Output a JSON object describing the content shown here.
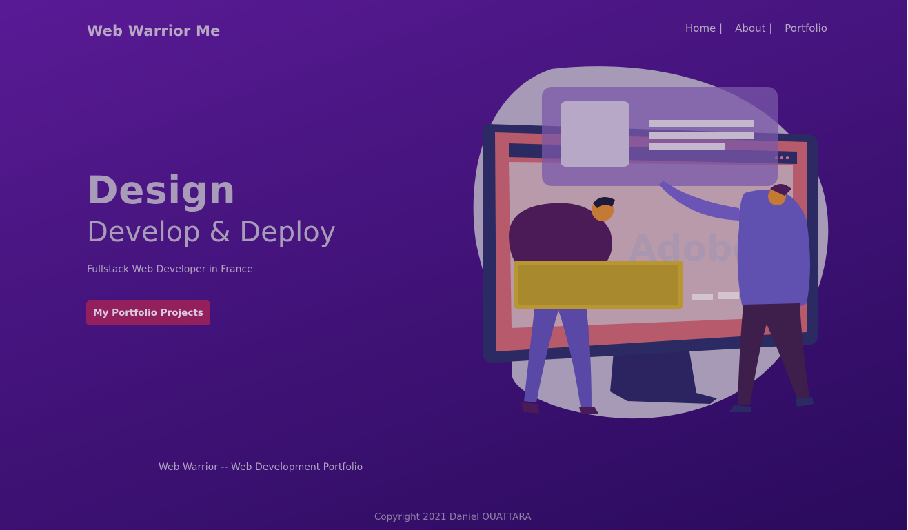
{
  "header": {
    "brand": "Web Warrior Me",
    "nav": [
      {
        "label": "Home |"
      },
      {
        "label": "About |"
      },
      {
        "label": "Portfolio"
      }
    ]
  },
  "hero": {
    "title": "Design",
    "subtitle": "Develop & Deploy",
    "description": "Fullstack Web Developer in France",
    "cta_label": "My Portfolio Projects"
  },
  "illustration": {
    "banner_text": "Adobe",
    "icons": [
      "monitor-illustration",
      "adobe-logo-icon"
    ]
  },
  "footer": {
    "title": "Web Warrior -- Web Development Portfolio",
    "copyright": "Copyright 2021 Daniel OUATTARA"
  },
  "colors": {
    "background_top": "#5a1a96",
    "background_bottom": "#2a0b5c",
    "accent": "#93205c",
    "text": "#b7a9c4"
  }
}
